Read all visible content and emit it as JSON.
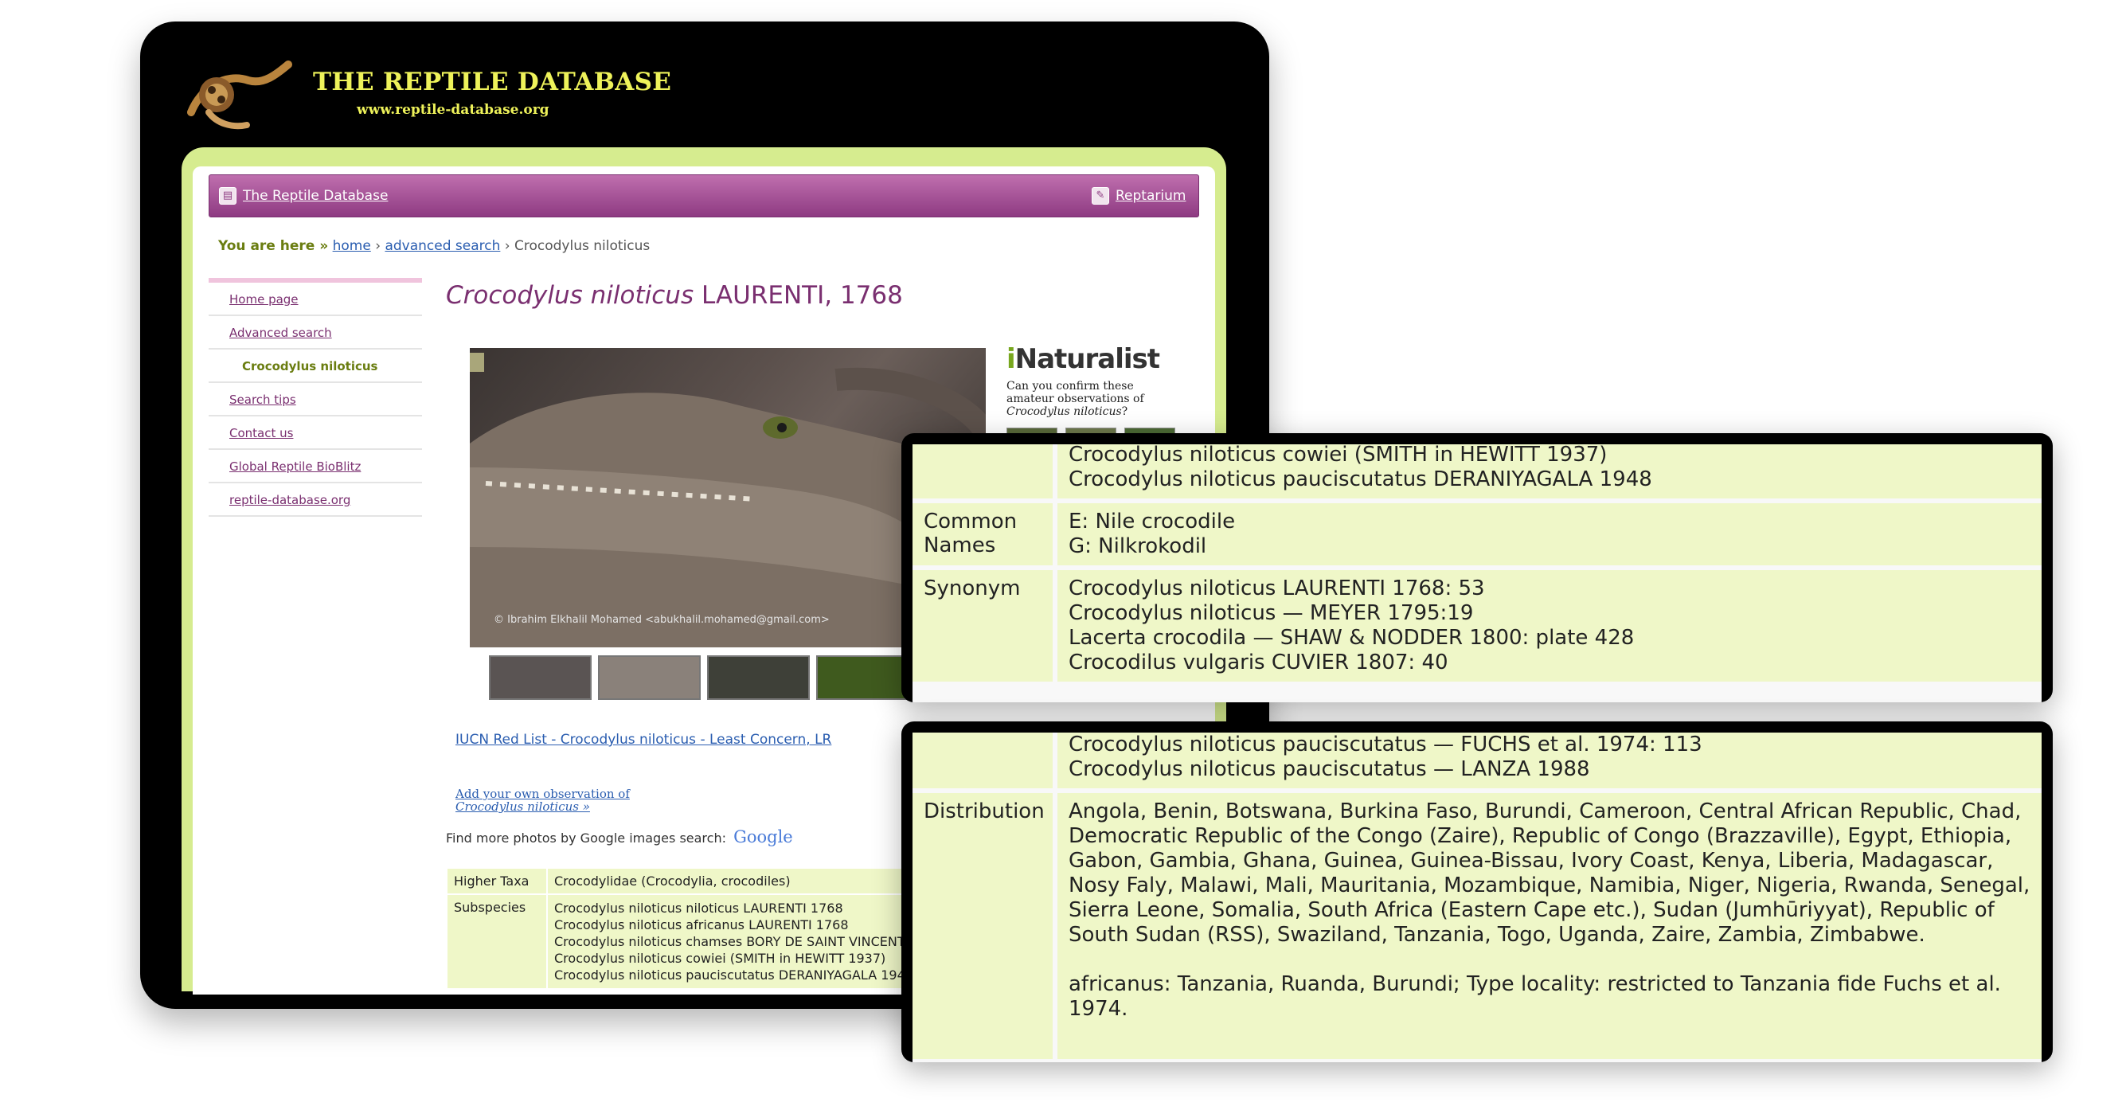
{
  "banner": {
    "title": "THE REPTILE DATABASE",
    "url": "www.reptile-database.org"
  },
  "topbar": {
    "home_link": "The Reptile Database",
    "reptarium_link": "Reptarium"
  },
  "breadcrumb": {
    "label": "You are here »",
    "home": "home",
    "sep": "›",
    "advanced": "advanced search",
    "current": "Crocodylus niloticus"
  },
  "sidenav": {
    "items": [
      "Home page",
      "Advanced search",
      "Crocodylus niloticus",
      "Search tips",
      "Contact us",
      "Global Reptile BioBlitz",
      "reptile-database.org"
    ]
  },
  "species": {
    "name": "Crocodylus niloticus",
    "author": "LAURENTI, 1768"
  },
  "photo": {
    "credit": "© Ibrahim Elkhalil Mohamed <abukhalil.mohamed@gmail.com>"
  },
  "iucn_link": "IUCN Red List - Crocodylus niloticus - Least Concern, LR",
  "observe": {
    "line1": "Add your own observation of",
    "line2": "Crocodylus niloticus »"
  },
  "google": {
    "text": "Find more photos by Google images search:",
    "logo": "Google"
  },
  "inaturalist": {
    "logo_i": "i",
    "logo_rest": "Naturalist",
    "text1": "Can you confirm these amateur observations of",
    "text2": "Crocodylus niloticus",
    "text3": "?"
  },
  "taxonomy_table": {
    "higher_taxa_label": "Higher Taxa",
    "higher_taxa_value": "Crocodylidae (Crocodylia, crocodiles)",
    "subspecies_label": "Subspecies",
    "subspecies": [
      "Crocodylus niloticus niloticus LAURENTI 1768",
      "Crocodylus niloticus africanus LAURENTI 1768",
      "Crocodylus niloticus chamses BORY DE SAINT VINCENT",
      "Crocodylus niloticus cowiei (SMITH in HEWITT 1937)",
      "Crocodylus niloticus pauciscutatus DERANIYAGALA 1948"
    ]
  },
  "zoom_top": {
    "subspecies_tail": [
      "Crocodylus niloticus cowiei (SMITH in HEWITT 1937)",
      "Crocodylus niloticus pauciscutatus DERANIYAGALA 1948"
    ],
    "common_names_label": "Common Names",
    "common_names": [
      "E: Nile crocodile",
      "G: Nilkrokodil"
    ],
    "synonym_label": "Synonym",
    "synonyms": [
      "Crocodylus niloticus LAURENTI 1768: 53",
      "Crocodylus niloticus — MEYER 1795:19",
      "Lacerta crocodila — SHAW & NODDER 1800: plate 428",
      "Crocodilus vulgaris CUVIER 1807: 40"
    ]
  },
  "zoom_bottom": {
    "synonym_tail": [
      "Crocodylus niloticus pauciscutatus — FUCHS et al. 1974: 113",
      "Crocodylus niloticus pauciscutatus — LANZA 1988"
    ],
    "distribution_label": "Distribution",
    "distribution": "Angola, Benin, Botswana, Burkina Faso, Burundi, Cameroon, Central African Republic, Chad, Democratic Republic of the Congo (Zaire), Republic of Congo (Brazzaville), Egypt, Ethiopia, Gabon, Gambia, Ghana, Guinea, Guinea-Bissau, Ivory Coast, Kenya, Liberia, Madagascar, Nosy Faly, Malawi, Mali, Mauritania, Mozambique, Namibia, Niger, Nigeria, Rwanda, Senegal, Sierra Leone, Somalia, South Africa (Eastern Cape etc.), Sudan (Jumhūriyyat), Republic of South Sudan (RSS), Swaziland, Tanzania, Togo, Uganda, Zaire, Zambia, Zimbabwe.",
    "distribution_note": "africanus: Tanzania, Ruanda, Burundi; Type locality: restricted to Tanzania fide Fuchs et al. 1974."
  },
  "colors": {
    "banner_text": "#eef25a",
    "frame_green": "#d6ec8f",
    "topbar_purple": "#8e3b82",
    "table_green": "#eff7c8",
    "link_blue": "#2a5db0"
  }
}
